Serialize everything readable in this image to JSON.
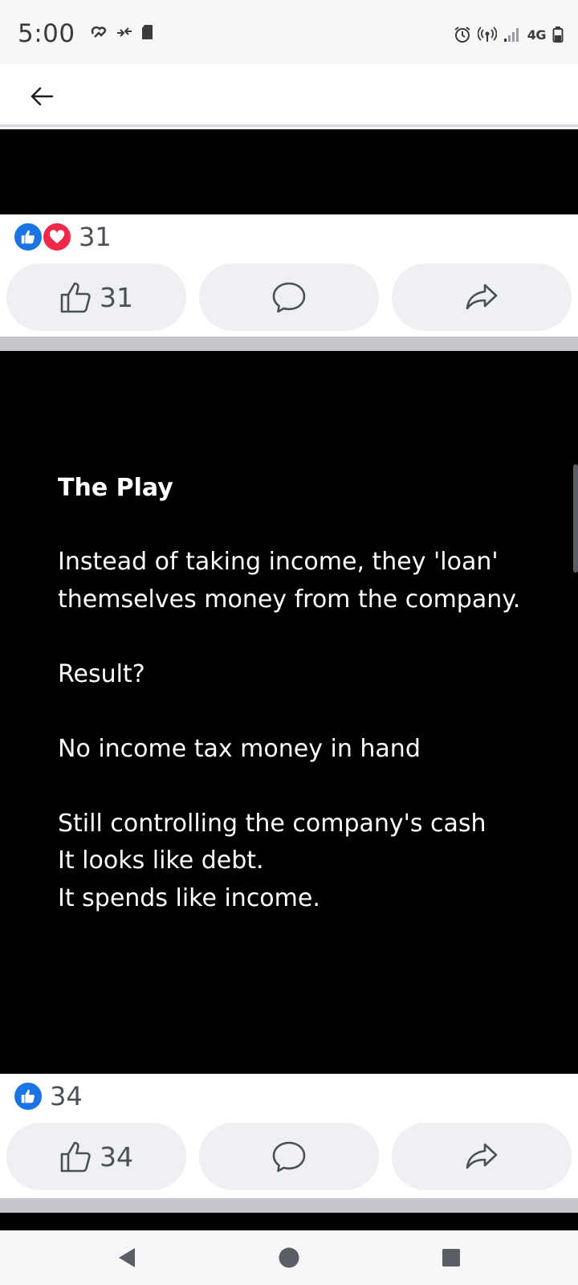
{
  "status_bar": {
    "time": "5:00",
    "network": "4G",
    "icons": [
      "cloud-sync-icon",
      "data-transfer-icon",
      "sd-card-icon",
      "alarm-icon",
      "hotspot-icon",
      "signal-icon",
      "battery-icon"
    ]
  },
  "nav": {
    "back_icon": "arrow-left-icon"
  },
  "posts": [
    {
      "reaction_count": "31",
      "like_count": "31",
      "reaction_types": [
        "like",
        "love"
      ]
    },
    {
      "title": "The Play",
      "para1": "Instead of taking income, they 'loan' themselves money from the company.",
      "para2": "Result?",
      "para3": "No income tax money in hand",
      "para4_line1": "Still controlling the company's cash",
      "para4_line2": "It looks like debt.",
      "para4_line3": "It spends like income.",
      "reaction_count": "34",
      "like_count": "34",
      "reaction_types": [
        "like"
      ]
    }
  ],
  "colors": {
    "like_blue": "#1b74e4",
    "love_red": "#f02849",
    "media_bg": "#000000",
    "button_bg": "#eef0f3"
  },
  "system_nav": [
    "back-triangle-icon",
    "home-circle-icon",
    "recents-square-icon"
  ]
}
